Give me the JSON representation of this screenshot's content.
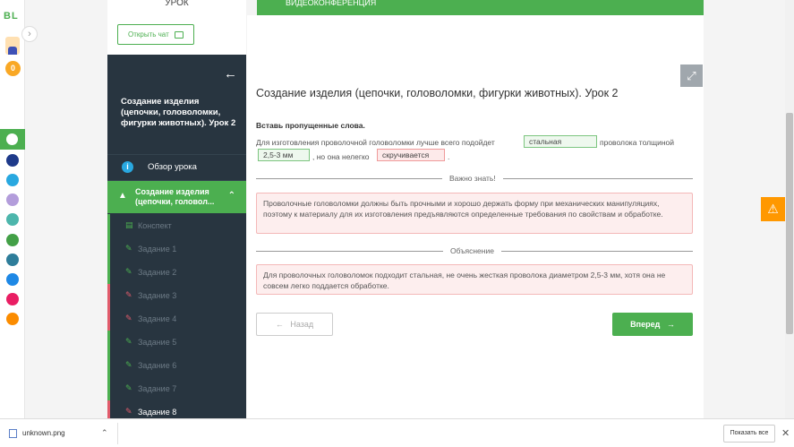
{
  "rail": {
    "logo": "BL",
    "coins": "0",
    "app_icons": [
      {
        "name": "app-icon-blue-1",
        "color": "#1e3a8a"
      },
      {
        "name": "app-icon-help",
        "color": "#29a8e0"
      },
      {
        "name": "app-icon-purple",
        "color": "#b39ddb"
      },
      {
        "name": "app-icon-teal",
        "color": "#4db6ac"
      },
      {
        "name": "app-icon-green",
        "color": "#43a047"
      },
      {
        "name": "app-icon-blue-2",
        "color": "#2e7d9a"
      },
      {
        "name": "app-icon-blue-3",
        "color": "#1e88e5"
      },
      {
        "name": "app-icon-red",
        "color": "#e91e63"
      },
      {
        "name": "app-icon-orange",
        "color": "#fb8c00"
      }
    ]
  },
  "sidebar": {
    "lesson_label": "УРОК",
    "chat_button": "Открыть чат",
    "title": "Создание изделия (цепочки, головоломки, фигурки животных). Урок 2",
    "overview": "Обзор урока",
    "section": "Создание изделия (цепочки, головол...",
    "items": [
      {
        "label": "Конспект",
        "status": "ok",
        "icon": "book-icon"
      },
      {
        "label": "Задание 1",
        "status": "ok",
        "icon": "edit-icon"
      },
      {
        "label": "Задание 2",
        "status": "ok",
        "icon": "edit-icon"
      },
      {
        "label": "Задание 3",
        "status": "bad",
        "icon": "edit-icon"
      },
      {
        "label": "Задание 4",
        "status": "bad",
        "icon": "edit-icon"
      },
      {
        "label": "Задание 5",
        "status": "ok",
        "icon": "edit-icon"
      },
      {
        "label": "Задание 6",
        "status": "ok",
        "icon": "edit-icon"
      },
      {
        "label": "Задание 7",
        "status": "ok",
        "icon": "edit-icon"
      },
      {
        "label": "Задание 8",
        "status": "bad",
        "icon": "edit-icon"
      }
    ]
  },
  "topbar": {
    "label": "ВИДЕОКОНФЕРЕНЦИЯ"
  },
  "main": {
    "heading": "Создание изделия (цепочки, головоломки, фигурки животных). Урок 2",
    "instruction": "Вставь пропущенные слова.",
    "sentence_part1": "Для изготовления проволочной головоломки лучше всего подойдет",
    "answer1": "стальная",
    "sentence_part2": "проволока толщиной",
    "answer2": "2,5-3 мм",
    "sentence_part3": ", но она нелегко",
    "answer3": "скручивается",
    "sentence_part4": ".",
    "important_label": "Важно знать!",
    "important_text": "Проволочные головоломки должны быть прочными и хорошо держать форму при механических манипуляциях, поэтому к материалу для их изготовления предъявляются определенные требования по свойствам и обработке.",
    "explanation_label": "Объяснение",
    "explanation_text": "Для проволочных головоломок подходит стальная, не очень жесткая проволока диаметром 2,5-3 мм, хотя она не совсем легко поддается обработке.",
    "back_button": "Назад",
    "next_button": "Вперед"
  },
  "download_bar": {
    "file_name": "unknown.png",
    "show_all": "Показать все"
  },
  "colors": {
    "green": "#4caf50",
    "dark": "#283540",
    "error": "#e05b6b",
    "warning": "#ff9800"
  }
}
